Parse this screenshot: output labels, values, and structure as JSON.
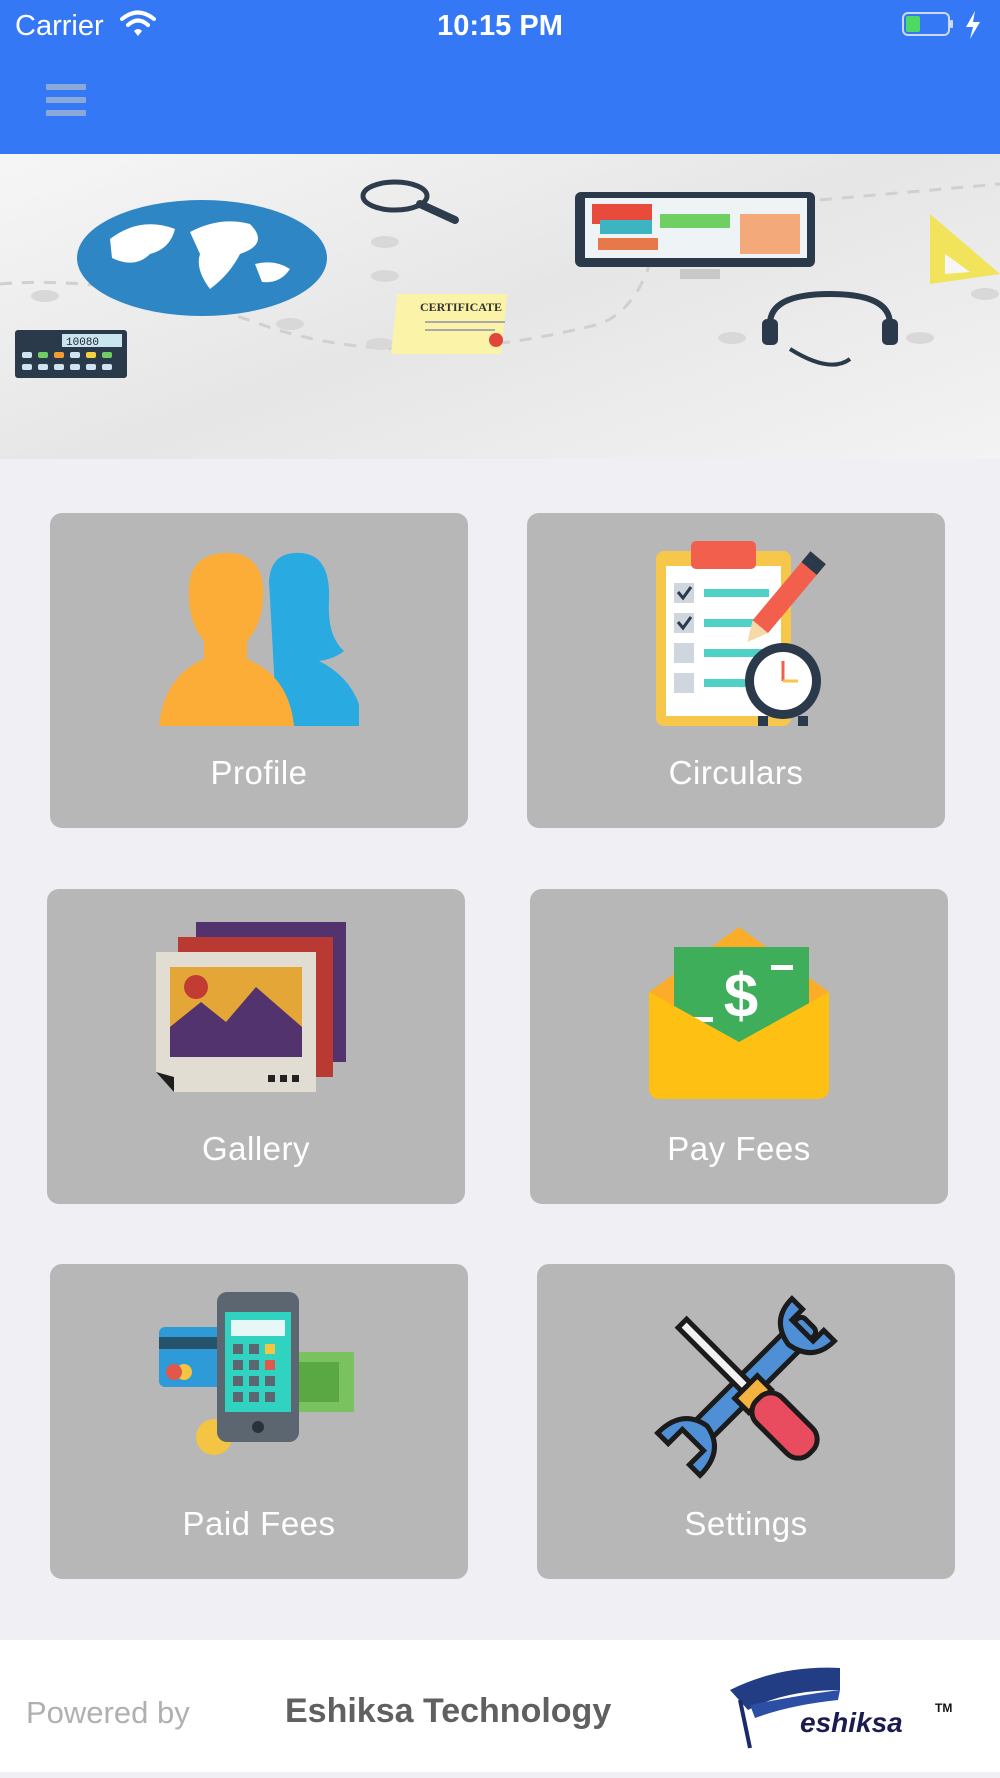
{
  "status": {
    "carrier": "Carrier",
    "time": "10:15 PM",
    "battery_level": 0.35
  },
  "nav": {
    "menu_icon": "hamburger-menu-icon"
  },
  "banner": {
    "certificate_text": "CERTIFICATE",
    "calculator_display": "10080"
  },
  "tiles": [
    {
      "label": "Profile",
      "icon": "profile-icon"
    },
    {
      "label": "Circulars",
      "icon": "circulars-icon"
    },
    {
      "label": "Gallery",
      "icon": "gallery-icon"
    },
    {
      "label": "Pay Fees",
      "icon": "pay-fees-icon"
    },
    {
      "label": "Paid Fees",
      "icon": "paid-fees-icon"
    },
    {
      "label": "Settings",
      "icon": "settings-icon"
    }
  ],
  "footer": {
    "powered_by": "Powered by",
    "company": "Eshiksa Technology",
    "logo_text": "eshiksa",
    "logo_tm": "TM"
  },
  "colors": {
    "header": "#3478f6",
    "tile": "#b7b7b7",
    "background": "#efeff4"
  }
}
